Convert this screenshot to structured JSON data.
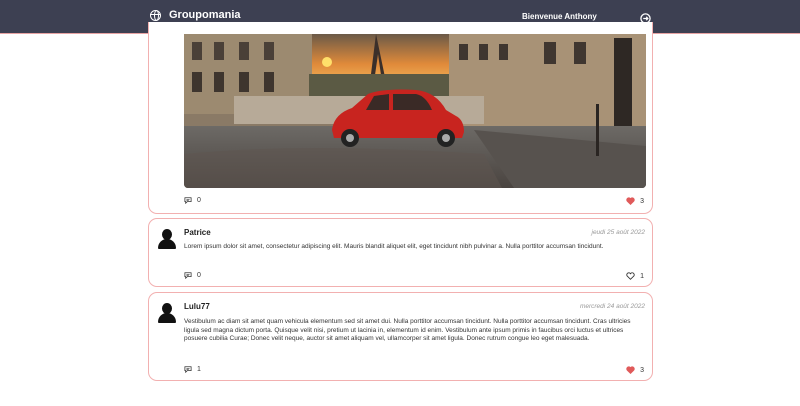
{
  "header": {
    "brand": "Groupomania",
    "welcome": "Bienvenue Anthony"
  },
  "posts": [
    {
      "comments": "0",
      "likes": "3",
      "liked": true
    },
    {
      "author": "Patrice",
      "date": "jeudi 25 août 2022",
      "text": "Lorem ipsum dolor sit amet, consectetur adipiscing elit. Mauris blandit aliquet elit, eget tincidunt nibh pulvinar a. Nulla porttitor accumsan tincidunt.",
      "comments": "0",
      "likes": "1",
      "liked": false
    },
    {
      "author": "Lulu77",
      "date": "mercredi 24 août 2022",
      "text": "Vestibulum ac diam sit amet quam vehicula elementum sed sit amet dui. Nulla porttitor accumsan tincidunt. Nulla porttitor accumsan tincidunt. Cras ultricies ligula sed magna dictum porta. Quisque velit nisi, pretium ut lacinia in, elementum id enim. Vestibulum ante ipsum primis in faucibus orci luctus et ultrices posuere cubilia Curae; Donec velit neque, auctor sit amet aliquam vel, ullamcorper sit amet ligula. Donec rutrum congue leo eget malesuada.",
      "comments": "1",
      "likes": "3",
      "liked": true
    }
  ],
  "colors": {
    "header_bg": "#3d4052",
    "card_border": "#f2b0b0",
    "heart_red": "#e05a5a"
  },
  "icons": [
    "globe-icon",
    "logout-icon",
    "comment-icon",
    "heart-icon",
    "avatar-icon"
  ]
}
